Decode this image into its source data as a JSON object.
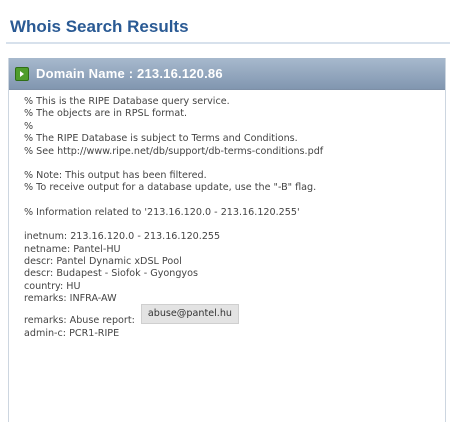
{
  "page": {
    "title": "Whois Search Results"
  },
  "result": {
    "domain_header": "Domain Name : 213.16.120.86",
    "icon": "expand-arrow-icon",
    "header_lines": [
      "% This is the RIPE Database query service.",
      "% The objects are in RPSL format.",
      "%",
      "% The RIPE Database is subject to Terms and Conditions.",
      "% See http://www.ripe.net/db/support/db-terms-conditions.pdf"
    ],
    "note_lines": [
      "% Note: This output has been filtered.",
      "% To receive output for a database update, use the \"-B\" flag."
    ],
    "info_line": "% Information related to '213.16.120.0 - 213.16.120.255'",
    "record_lines": [
      "inetnum: 213.16.120.0 - 213.16.120.255",
      "netname: Pantel-HU",
      "descr: Pantel Dynamic xDSL Pool",
      "descr: Budapest - Siofok - Gyongyos",
      "country: HU",
      "remarks: INFRA-AW"
    ],
    "abuse_label": "remarks: Abuse report:",
    "abuse_email": "abuse@pantel.hu",
    "admin_line": "admin-c: PCR1-RIPE"
  },
  "colors": {
    "title": "#2a5a94",
    "header_bg": "#8fa3bb",
    "icon": "#4f9d2b",
    "text": "#444444"
  }
}
